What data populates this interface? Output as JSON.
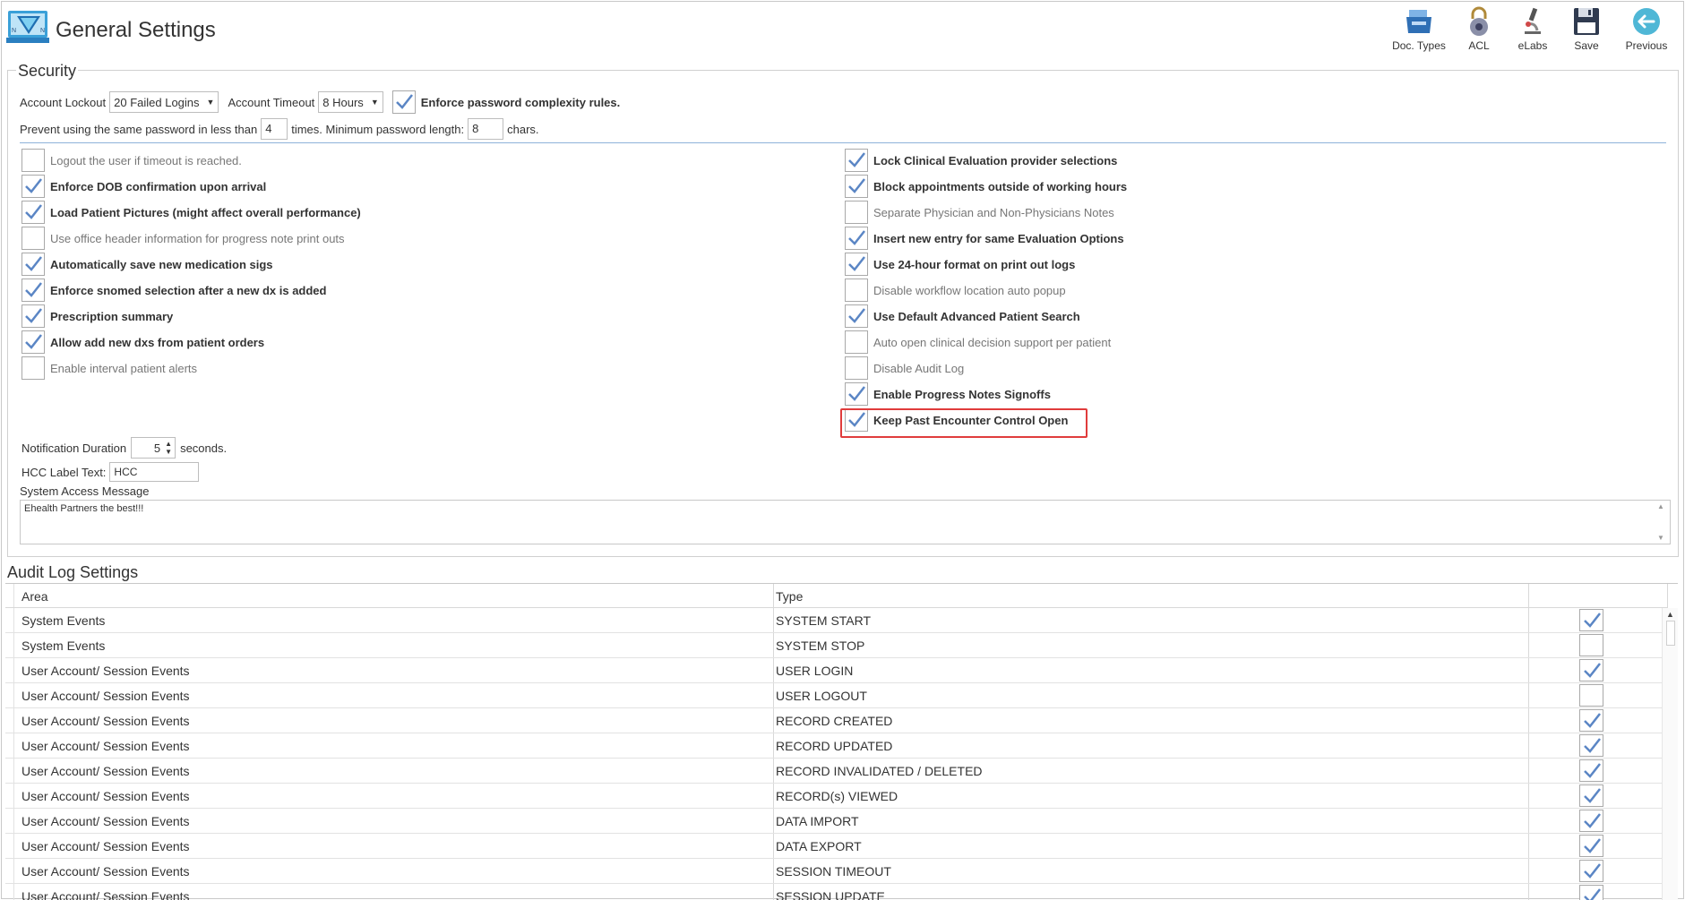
{
  "app": {
    "title": "General Settings"
  },
  "toolbar": [
    {
      "label": "Doc. Types",
      "icon": "doc-types-icon"
    },
    {
      "label": "ACL",
      "icon": "lock-icon"
    },
    {
      "label": "eLabs",
      "icon": "microscope-icon"
    },
    {
      "label": "Save",
      "icon": "save-icon"
    },
    {
      "label": "Previous",
      "icon": "back-arrow-icon"
    }
  ],
  "security": {
    "legend": "Security",
    "account_lockout_label": "Account Lockout",
    "account_lockout_value": "20 Failed Logins",
    "account_timeout_label": "Account Timeout",
    "account_timeout_value": "8 Hours",
    "enforce_complexity_label": "Enforce password complexity rules.",
    "enforce_complexity_checked": true,
    "prevent_reuse_prefix": "Prevent using the same password in less than",
    "prevent_reuse_value": "4",
    "prevent_reuse_suffix": "times. Minimum password length:",
    "min_length_value": "8",
    "min_length_suffix": "chars.",
    "left_options": [
      {
        "label": "Logout the user if timeout is reached.",
        "checked": false
      },
      {
        "label": "Enforce DOB confirmation upon arrival",
        "checked": true
      },
      {
        "label": "Load Patient Pictures (might affect overall performance)",
        "checked": true
      },
      {
        "label": "Use office header information for progress note print outs",
        "checked": false
      },
      {
        "label": "Automatically save new medication sigs",
        "checked": true
      },
      {
        "label": "Enforce snomed selection after a new dx is added",
        "checked": true
      },
      {
        "label": "Prescription summary",
        "checked": true
      },
      {
        "label": "Allow add new dxs from patient orders",
        "checked": true
      },
      {
        "label": "Enable interval patient alerts",
        "checked": false
      }
    ],
    "right_options": [
      {
        "label": "Lock Clinical Evaluation provider selections",
        "checked": true
      },
      {
        "label": "Block appointments outside of working hours",
        "checked": true
      },
      {
        "label": "Separate Physician and Non-Physicians Notes",
        "checked": false
      },
      {
        "label": "Insert new entry for same Evaluation Options",
        "checked": true
      },
      {
        "label": "Use 24-hour format on print out logs",
        "checked": true
      },
      {
        "label": "Disable workflow location auto popup",
        "checked": false
      },
      {
        "label": "Use Default Advanced Patient Search",
        "checked": true
      },
      {
        "label": "Auto open clinical decision support per patient",
        "checked": false
      },
      {
        "label": "Disable Audit Log",
        "checked": false
      },
      {
        "label": "Enable Progress Notes Signoffs",
        "checked": true
      },
      {
        "label": "Keep Past Encounter Control Open",
        "checked": true
      }
    ],
    "notification_label": "Notification Duration",
    "notification_value": "5",
    "notification_suffix": "seconds.",
    "hcc_label": "HCC Label Text:",
    "hcc_value": "HCC",
    "system_access_label": "System Access Message",
    "system_access_value": "Ehealth Partners the best!!!"
  },
  "audit": {
    "title": "Audit Log Settings",
    "columns": [
      "Area",
      "Type"
    ],
    "rows": [
      {
        "area": "System Events",
        "type": "SYSTEM START",
        "checked": true
      },
      {
        "area": "System Events",
        "type": "SYSTEM STOP",
        "checked": false
      },
      {
        "area": "User Account/ Session Events",
        "type": "USER LOGIN",
        "checked": true
      },
      {
        "area": "User Account/ Session Events",
        "type": "USER LOGOUT",
        "checked": false
      },
      {
        "area": "User Account/ Session Events",
        "type": "RECORD CREATED",
        "checked": true
      },
      {
        "area": "User Account/ Session Events",
        "type": "RECORD UPDATED",
        "checked": true
      },
      {
        "area": "User Account/ Session Events",
        "type": "RECORD INVALIDATED / DELETED",
        "checked": true
      },
      {
        "area": "User Account/ Session Events",
        "type": "RECORD(s) VIEWED",
        "checked": true
      },
      {
        "area": "User Account/ Session Events",
        "type": "DATA IMPORT",
        "checked": true
      },
      {
        "area": "User Account/ Session Events",
        "type": "DATA EXPORT",
        "checked": true
      },
      {
        "area": "User Account/ Session Events",
        "type": "SESSION TIMEOUT",
        "checked": true
      },
      {
        "area": "User Account/ Session Events",
        "type": "SESSION UPDATE",
        "checked": true
      }
    ]
  },
  "colors": {
    "accent": "#4a90d9",
    "check": "#5b86c5",
    "highlight": "#e03c3c"
  }
}
